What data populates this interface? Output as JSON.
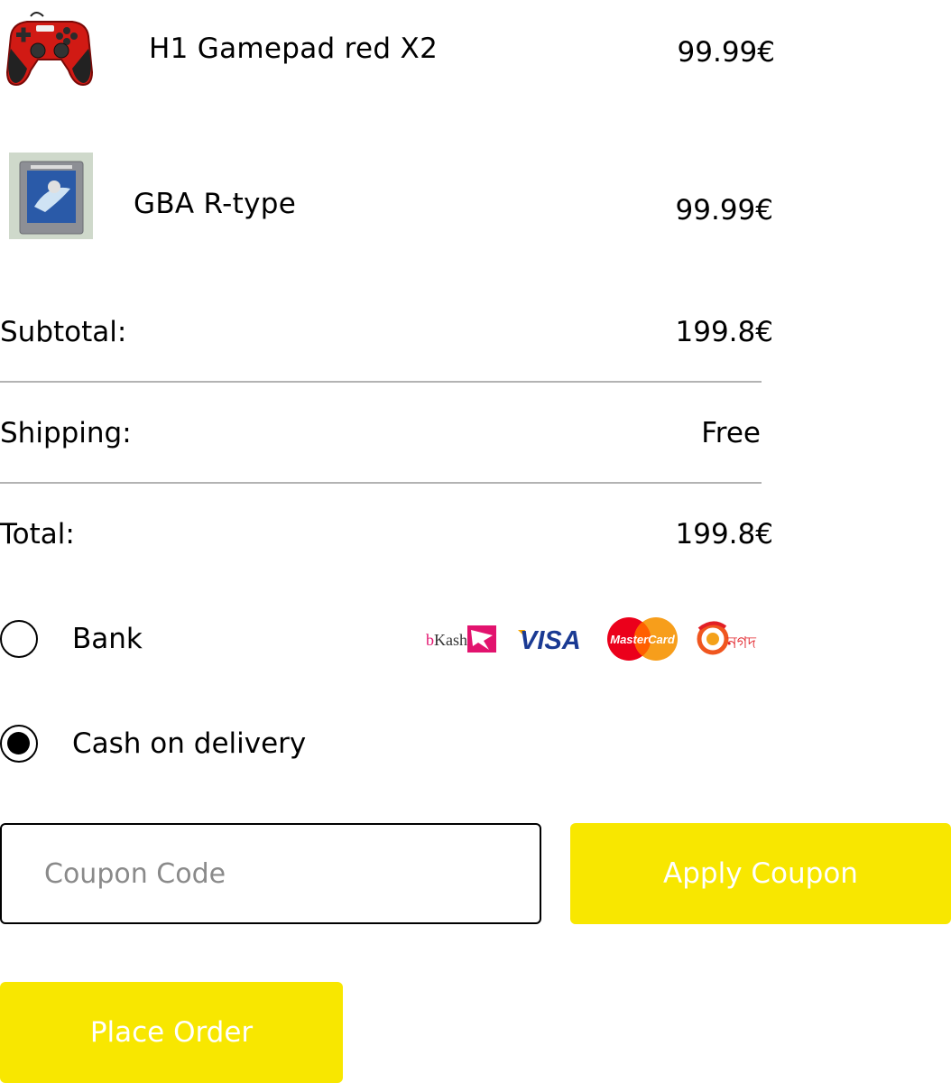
{
  "cart": {
    "items": [
      {
        "name": "H1 Gamepad red X2",
        "price": "99.99€",
        "image_icon": "gamepad-image"
      },
      {
        "name": "GBA R-type",
        "price": "99.99€",
        "image_icon": "game-cartridge-image"
      }
    ]
  },
  "summary": {
    "subtotal_label": "Subtotal:",
    "subtotal_value": "199.8€",
    "shipping_label": "Shipping:",
    "shipping_value": "Free",
    "total_label": "Total:",
    "total_value": "199.8€"
  },
  "payment": {
    "options": [
      {
        "label": "Bank",
        "selected": false
      },
      {
        "label": "Cash on delivery",
        "selected": true
      }
    ],
    "logos": {
      "bkash": "bKash",
      "visa": "VISA",
      "mastercard": "MasterCard",
      "nagad": "নগদ"
    }
  },
  "coupon": {
    "placeholder": "Coupon Code",
    "value": "",
    "apply_label": "Apply Coupon"
  },
  "order": {
    "place_label": "Place Order"
  },
  "colors": {
    "accent": "#f8e700",
    "button_text": "#ffffff",
    "divider": "#b3b3b3",
    "placeholder": "#8a8a8a"
  }
}
